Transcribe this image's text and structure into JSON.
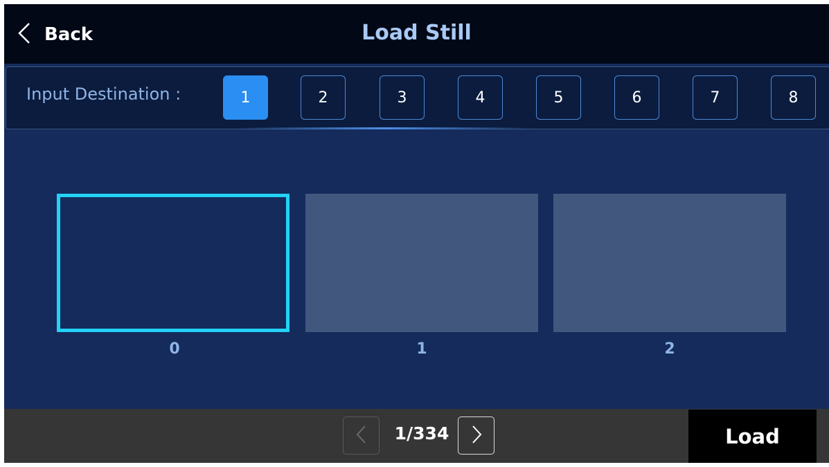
{
  "header": {
    "back_label": "Back",
    "back_icon": "chevron-left-icon",
    "title": "Load Still"
  },
  "destination": {
    "label": "Input Destination :",
    "options": [
      "1",
      "2",
      "3",
      "4",
      "5",
      "6",
      "7",
      "8"
    ],
    "selected": "1"
  },
  "stills": [
    {
      "label": "0",
      "selected": true
    },
    {
      "label": "1",
      "selected": false
    },
    {
      "label": "2",
      "selected": false
    }
  ],
  "pagination": {
    "text": "1/334",
    "prev_icon": "chevron-left-icon",
    "next_icon": "chevron-right-icon",
    "prev_enabled": false,
    "next_enabled": true
  },
  "actions": {
    "load_label": "Load"
  },
  "colors": {
    "background": "#142b5c",
    "header": "#020816",
    "accent": "#2b8ef2",
    "selection": "#22d3f5",
    "thumbnail": "#41577d",
    "footer": "#363636"
  }
}
